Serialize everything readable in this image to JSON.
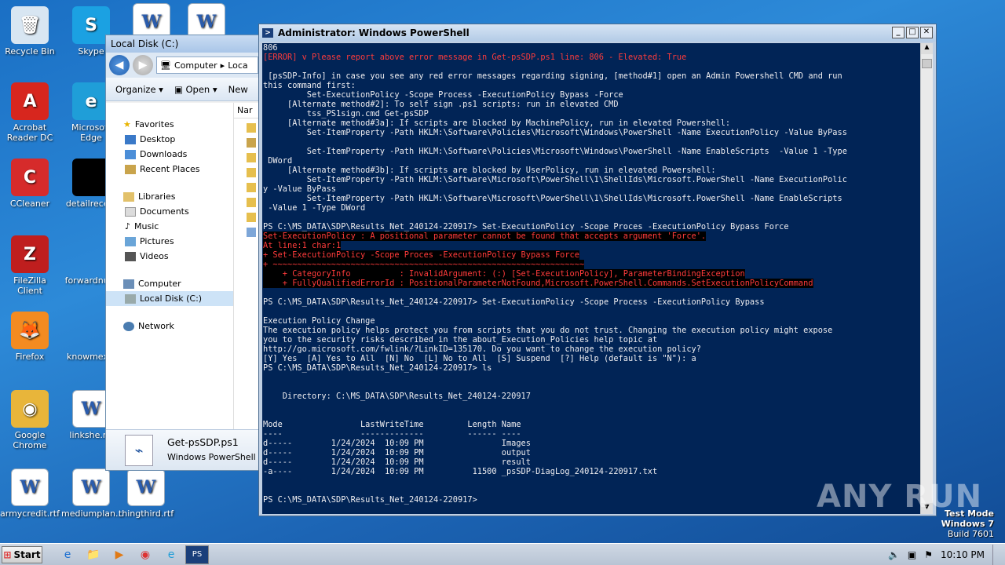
{
  "desktop": {
    "icons": [
      {
        "label": "Recycle Bin",
        "glyph": "🗑",
        "bg": "#d8e6f2"
      },
      {
        "label": "Skype",
        "glyph": "S",
        "bg": "#1ba1e2"
      },
      {
        "label": "Acrobat Reader DC",
        "glyph": "A",
        "bg": "#d7261e"
      },
      {
        "label": "Microsoft Edge",
        "glyph": "e",
        "bg": "#1f9ed8"
      },
      {
        "label": "CCleaner",
        "glyph": "C",
        "bg": "#d62b2b"
      },
      {
        "label": "detailreceiv",
        "glyph": "",
        "bg": "#000000"
      },
      {
        "label": "FileZilla Client",
        "glyph": "Z",
        "bg": "#bf1e1e"
      },
      {
        "label": "forwardnum",
        "glyph": "",
        "bg": "transparent"
      },
      {
        "label": "Firefox",
        "glyph": "🦊",
        "bg": "#f38b21"
      },
      {
        "label": "knowmexic",
        "glyph": "",
        "bg": "transparent"
      },
      {
        "label": "Google Chrome",
        "glyph": "◉",
        "bg": "#e8b53a"
      },
      {
        "label": "linkshe.rtf",
        "glyph": "W",
        "bg": "#ffffff"
      },
      {
        "label": "armycredit.rtf",
        "glyph": "W",
        "bg": "#ffffff"
      },
      {
        "label": "mediumplan...",
        "glyph": "W",
        "bg": "#ffffff"
      },
      {
        "label": "thingthird.rtf",
        "glyph": "W",
        "bg": "#ffffff"
      }
    ]
  },
  "explorer": {
    "title": "Local Disk (C:)",
    "address": [
      "Computer",
      "Loca"
    ],
    "toolbar": {
      "organize": "Organize",
      "open": "Open",
      "new": "New"
    },
    "nav": {
      "favorites": "Favorites",
      "fav_items": [
        "Desktop",
        "Downloads",
        "Recent Places"
      ],
      "libraries": "Libraries",
      "lib_items": [
        "Documents",
        "Music",
        "Pictures",
        "Videos"
      ],
      "computer": "Computer",
      "local_disk": "Local Disk (C:)",
      "network": "Network"
    },
    "column_header": "Nar",
    "details": {
      "filename": "Get-psSDP.ps1",
      "filetype": "Windows PowerShell Scri"
    }
  },
  "powershell": {
    "title": "Administrator: Windows PowerShell",
    "lines": [
      {
        "t": "806",
        "c": ""
      },
      {
        "t": "[ERROR] v Please report above error message in Get-psSDP.ps1 line: 806 - Elevated: True",
        "c": "err"
      },
      {
        "t": "",
        "c": ""
      },
      {
        "t": " [psSDP-Info] in case you see any red error messages regarding signing, [method#1] open an Admin Powershell CMD and run",
        "c": ""
      },
      {
        "t": "this command first:",
        "c": ""
      },
      {
        "t": "         Set-ExecutionPolicy -Scope Process -ExecutionPolicy Bypass -Force",
        "c": ""
      },
      {
        "t": "     [Alternate method#2]: To self sign .ps1 scripts: run in elevated CMD",
        "c": ""
      },
      {
        "t": "         tss_PS1sign.cmd Get-psSDP",
        "c": ""
      },
      {
        "t": "     [Alternate method#3a]: If scripts are blocked by MachinePolicy, run in elevated Powershell:",
        "c": ""
      },
      {
        "t": "         Set-ItemProperty -Path HKLM:\\Software\\Policies\\Microsoft\\Windows\\PowerShell -Name ExecutionPolicy -Value ByPass",
        "c": ""
      },
      {
        "t": "",
        "c": ""
      },
      {
        "t": "         Set-ItemProperty -Path HKLM:\\Software\\Policies\\Microsoft\\Windows\\PowerShell -Name EnableScripts  -Value 1 -Type",
        "c": ""
      },
      {
        "t": " DWord",
        "c": ""
      },
      {
        "t": "     [Alternate method#3b]: If scripts are blocked by UserPolicy, run in elevated Powershell:",
        "c": ""
      },
      {
        "t": "         Set-ItemProperty -Path HKLM:\\Software\\Microsoft\\PowerShell\\1\\ShellIds\\Microsoft.PowerShell -Name ExecutionPolic",
        "c": ""
      },
      {
        "t": "y -Value ByPass",
        "c": ""
      },
      {
        "t": "         Set-ItemProperty -Path HKLM:\\Software\\Microsoft\\PowerShell\\1\\ShellIds\\Microsoft.PowerShell -Name EnableScripts",
        "c": ""
      },
      {
        "t": " -Value 1 -Type DWord",
        "c": ""
      },
      {
        "t": "",
        "c": ""
      },
      {
        "t": "PS C:\\MS_DATA\\SDP\\Results_Net_240124-220917> Set-ExecutionPolicy -Scope Proces -ExecutionPolicy Bypass Force",
        "c": ""
      },
      {
        "t": "Set-ExecutionPolicy : A positional parameter cannot be found that accepts argument 'Force'.",
        "c": "errbg"
      },
      {
        "t": "At line:1 char:1",
        "c": "errbg"
      },
      {
        "t": "+ Set-ExecutionPolicy -Scope Proces -ExecutionPolicy Bypass Force",
        "c": "errbg"
      },
      {
        "t": "+ ~~~~~~~~~~~~~~~~~~~~~~~~~~~~~~~~~~~~~~~~~~~~~~~~~~~~~~~~~~~~~~~~",
        "c": "errbg"
      },
      {
        "t": "    + CategoryInfo          : InvalidArgument: (:) [Set-ExecutionPolicy], ParameterBindingException",
        "c": "errbg"
      },
      {
        "t": "    + FullyQualifiedErrorId : PositionalParameterNotFound,Microsoft.PowerShell.Commands.SetExecutionPolicyCommand",
        "c": "errbg"
      },
      {
        "t": "",
        "c": ""
      },
      {
        "t": "PS C:\\MS_DATA\\SDP\\Results_Net_240124-220917> Set-ExecutionPolicy -Scope Process -ExecutionPolicy Bypass",
        "c": ""
      },
      {
        "t": "",
        "c": ""
      },
      {
        "t": "Execution Policy Change",
        "c": ""
      },
      {
        "t": "The execution policy helps protect you from scripts that you do not trust. Changing the execution policy might expose",
        "c": ""
      },
      {
        "t": "you to the security risks described in the about_Execution_Policies help topic at",
        "c": ""
      },
      {
        "t": "http://go.microsoft.com/fwlink/?LinkID=135170. Do you want to change the execution policy?",
        "c": ""
      },
      {
        "t": "[Y] Yes  [A] Yes to All  [N] No  [L] No to All  [S] Suspend  [?] Help (default is \"N\"): a",
        "c": ""
      },
      {
        "t": "PS C:\\MS_DATA\\SDP\\Results_Net_240124-220917> ls",
        "c": ""
      },
      {
        "t": "",
        "c": ""
      },
      {
        "t": "",
        "c": ""
      },
      {
        "t": "    Directory: C:\\MS_DATA\\SDP\\Results_Net_240124-220917",
        "c": ""
      },
      {
        "t": "",
        "c": ""
      },
      {
        "t": "",
        "c": ""
      },
      {
        "t": "Mode                LastWriteTime         Length Name",
        "c": ""
      },
      {
        "t": "----                -------------         ------ ----",
        "c": ""
      },
      {
        "t": "d-----        1/24/2024  10:09 PM                Images",
        "c": ""
      },
      {
        "t": "d-----        1/24/2024  10:09 PM                output",
        "c": ""
      },
      {
        "t": "d-----        1/24/2024  10:09 PM                result",
        "c": ""
      },
      {
        "t": "-a----        1/24/2024  10:09 PM          11500 _psSDP-DiagLog_240124-220917.txt",
        "c": ""
      },
      {
        "t": "",
        "c": ""
      },
      {
        "t": "",
        "c": ""
      },
      {
        "t": "PS C:\\MS_DATA\\SDP\\Results_Net_240124-220917>",
        "c": ""
      }
    ]
  },
  "taskbar": {
    "start": "Start",
    "items": [
      "e",
      "📁",
      "▶",
      "◉",
      "e",
      "PS"
    ],
    "time": "10:10 PM"
  },
  "watermark": {
    "line1": "Test Mode",
    "line2": "Windows 7",
    "line3": "Build 7601"
  },
  "brand": "ANY RUN"
}
